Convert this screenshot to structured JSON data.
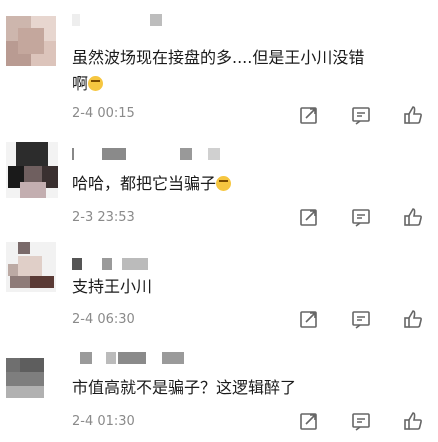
{
  "comments": [
    {
      "text_line1": "虽然波场现在接盘的多....但是王小川没错",
      "text_line2": "啊",
      "emoji": "laughing-tears-emoji",
      "time": "2-4 00:15"
    },
    {
      "text": "哈哈，都把它当骗子",
      "emoji": "laughing-emoji",
      "time": "2-3 23:53"
    },
    {
      "text": "支持王小川",
      "time": "2-4 06:30"
    },
    {
      "text": "市值高就不是骗子？这逻辑醉了",
      "time": "2-4 01:30"
    }
  ],
  "icons": {
    "share": "share-icon",
    "reply": "comment-icon",
    "like": "thumbs-up-icon"
  }
}
